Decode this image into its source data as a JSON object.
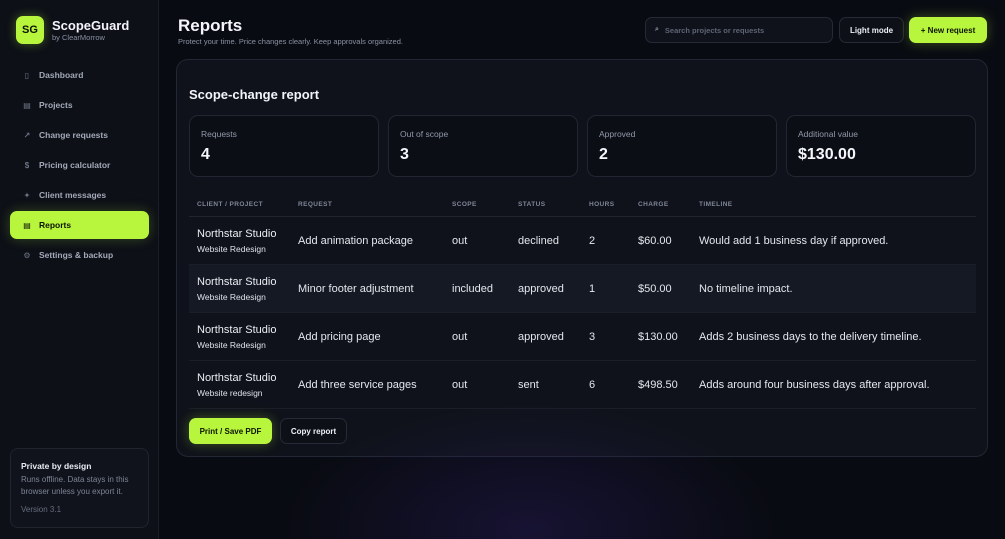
{
  "app": {
    "logo_text": "SG",
    "name": "ScopeGuard",
    "byline": "by ClearMorrow"
  },
  "sidebar": {
    "items": [
      {
        "label": "Dashboard",
        "icon": "grid-icon",
        "glyph": "▯"
      },
      {
        "label": "Projects",
        "icon": "folder-icon",
        "glyph": "▤"
      },
      {
        "label": "Change requests",
        "icon": "arrow-icon",
        "glyph": "↗"
      },
      {
        "label": "Pricing calculator",
        "icon": "dollar-icon",
        "glyph": "$"
      },
      {
        "label": "Client messages",
        "icon": "message-icon",
        "glyph": "✦"
      },
      {
        "label": "Reports",
        "icon": "report-icon",
        "glyph": "▤",
        "active": true
      },
      {
        "label": "Settings & backup",
        "icon": "gear-icon",
        "glyph": "⚙"
      }
    ],
    "privacy": {
      "title": "Private by design",
      "text": "Runs offline. Data stays in this browser unless you export it.",
      "version": "Version 3.1"
    }
  },
  "header": {
    "title": "Reports",
    "subtitle": "Protect your time. Price changes clearly. Keep approvals organized.",
    "search_placeholder": "Search projects or requests",
    "search_glyph": "⌕",
    "light_mode_label": "Light mode",
    "new_request_label": "+ New request"
  },
  "report": {
    "title": "Scope-change report",
    "stats": [
      {
        "label": "Requests",
        "value": "4"
      },
      {
        "label": "Out of scope",
        "value": "3"
      },
      {
        "label": "Approved",
        "value": "2"
      },
      {
        "label": "Additional value",
        "value": "$130.00"
      }
    ],
    "columns": [
      "CLIENT / PROJECT",
      "REQUEST",
      "SCOPE",
      "STATUS",
      "HOURS",
      "CHARGE",
      "TIMELINE"
    ],
    "rows": [
      {
        "client": "Northstar Studio",
        "project": "Website Redesign",
        "request": "Add animation package",
        "scope": "out",
        "status": "declined",
        "hours": "2",
        "charge": "$60.00",
        "timeline": "Would add 1 business day if approved."
      },
      {
        "client": "Northstar Studio",
        "project": "Website Redesign",
        "request": "Minor footer adjustment",
        "scope": "included",
        "status": "approved",
        "hours": "1",
        "charge": "$50.00",
        "timeline": "No timeline impact."
      },
      {
        "client": "Northstar Studio",
        "project": "Website Redesign",
        "request": "Add pricing page",
        "scope": "out",
        "status": "approved",
        "hours": "3",
        "charge": "$130.00",
        "timeline": "Adds 2 business days to the delivery timeline."
      },
      {
        "client": "Northstar Studio",
        "project": "Website redesign",
        "request": "Add three service pages",
        "scope": "out",
        "status": "sent",
        "hours": "6",
        "charge": "$498.50",
        "timeline": "Adds around four business days after approval."
      }
    ],
    "print_label": "Print / Save PDF",
    "copy_label": "Copy report"
  },
  "colors": {
    "accent": "#b8f53d",
    "background": "#090b12",
    "panel": "#0f121a"
  }
}
